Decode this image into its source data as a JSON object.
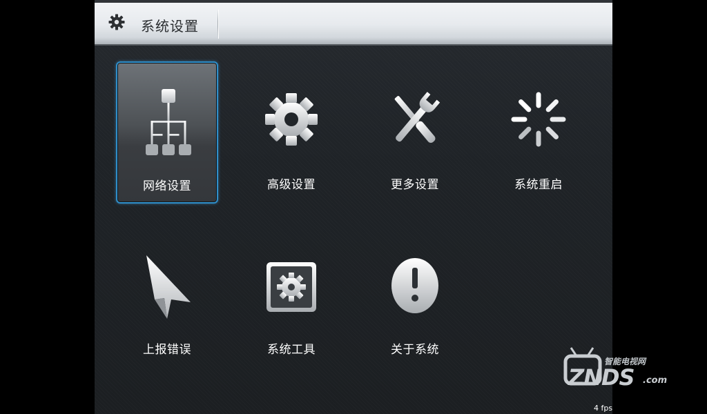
{
  "header": {
    "title": "系统设置",
    "icon": "gear-icon"
  },
  "menu": {
    "items": [
      {
        "label": "网络设置",
        "icon": "network-icon",
        "selected": true
      },
      {
        "label": "高级设置",
        "icon": "gear-icon",
        "selected": false
      },
      {
        "label": "更多设置",
        "icon": "tools-icon",
        "selected": false
      },
      {
        "label": "系统重启",
        "icon": "restart-icon",
        "selected": false
      },
      {
        "label": "上报错误",
        "icon": "send-report-icon",
        "selected": false
      },
      {
        "label": "系统工具",
        "icon": "system-tools-icon",
        "selected": false
      },
      {
        "label": "关于系统",
        "icon": "info-icon",
        "selected": false
      }
    ]
  },
  "watermark": {
    "cn": "智能电视网",
    "logo": "ZNDS",
    "suffix": ".com"
  },
  "status": {
    "fps": "4 fps"
  },
  "colors": {
    "accent": "#2f8ec9",
    "header_bg": "#e7eaee",
    "screen_bg": "#1f2327"
  }
}
